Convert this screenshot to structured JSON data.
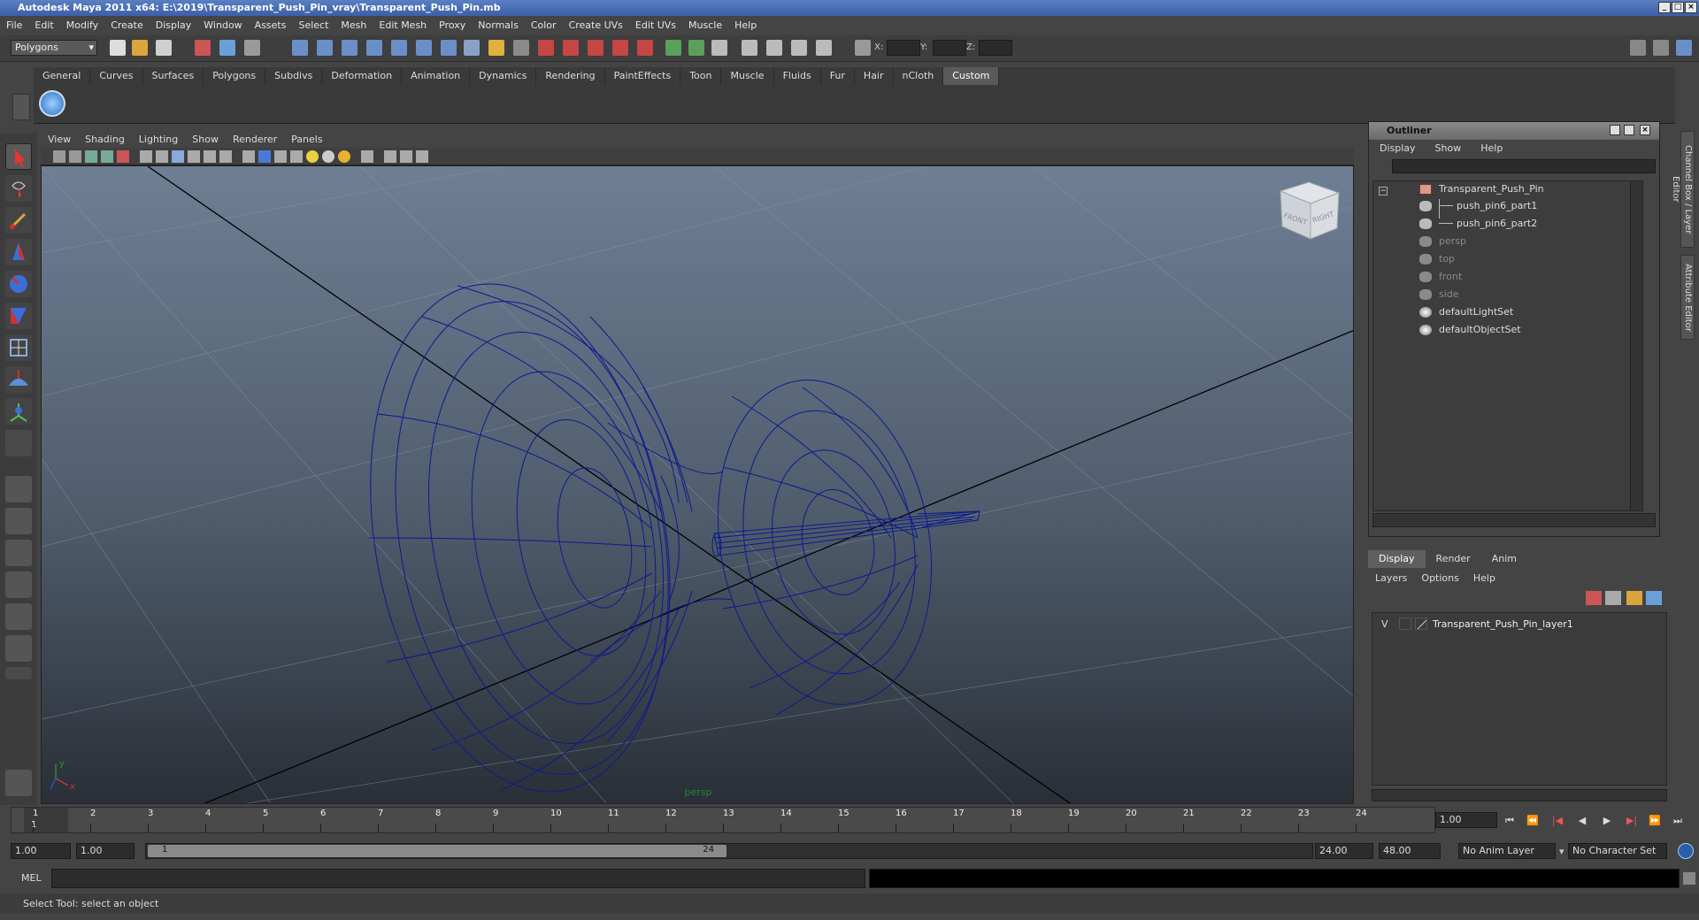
{
  "title": "Autodesk Maya 2011 x64: E:\\2019\\Transparent_Push_Pin_vray\\Transparent_Push_Pin.mb",
  "menubar": [
    "File",
    "Edit",
    "Modify",
    "Create",
    "Display",
    "Window",
    "Assets",
    "Select",
    "Mesh",
    "Edit Mesh",
    "Proxy",
    "Normals",
    "Color",
    "Create UVs",
    "Edit UVs",
    "Muscle",
    "Help"
  ],
  "toolbar": {
    "mode": "Polygons",
    "x_label": "X:",
    "y_label": "Y:",
    "z_label": "Z:"
  },
  "shelf_tabs": [
    "General",
    "Curves",
    "Surfaces",
    "Polygons",
    "Subdivs",
    "Deformation",
    "Animation",
    "Dynamics",
    "Rendering",
    "PaintEffects",
    "Toon",
    "Muscle",
    "Fluids",
    "Fur",
    "Hair",
    "nCloth",
    "Custom"
  ],
  "shelf_active": "Custom",
  "viewport": {
    "menu": [
      "View",
      "Shading",
      "Lighting",
      "Show",
      "Renderer",
      "Panels"
    ],
    "camera_label": "persp",
    "viewcube": {
      "front": "FRONT",
      "right": "RIGHT"
    },
    "axis": {
      "x": "x",
      "y": "y"
    }
  },
  "outliner": {
    "title": "Outliner",
    "menu": [
      "Display",
      "Show",
      "Help"
    ],
    "items": [
      {
        "label": "Transparent_Push_Pin",
        "icon": "group-icon",
        "dim": false
      },
      {
        "label": "push_pin6_part1",
        "icon": "mesh-icon",
        "dim": false
      },
      {
        "label": "push_pin6_part2",
        "icon": "mesh-icon",
        "dim": false
      },
      {
        "label": "persp",
        "icon": "camera-icon",
        "dim": true
      },
      {
        "label": "top",
        "icon": "camera-icon",
        "dim": true
      },
      {
        "label": "front",
        "icon": "camera-icon",
        "dim": true
      },
      {
        "label": "side",
        "icon": "camera-icon",
        "dim": true
      },
      {
        "label": "defaultLightSet",
        "icon": "set-icon",
        "dim": false
      },
      {
        "label": "defaultObjectSet",
        "icon": "set-icon",
        "dim": false
      }
    ]
  },
  "layer_editor": {
    "tabs": [
      "Display",
      "Render",
      "Anim"
    ],
    "active_tab": "Display",
    "menu": [
      "Layers",
      "Options",
      "Help"
    ],
    "layers": [
      {
        "visible": "V",
        "name": "Transparent_Push_Pin_layer1"
      }
    ]
  },
  "side_tabs": [
    "Channel Box / Layer Editor",
    "Attribute Editor"
  ],
  "timeline": {
    "frames": [
      "1",
      "2",
      "3",
      "4",
      "5",
      "6",
      "7",
      "8",
      "9",
      "10",
      "11",
      "12",
      "13",
      "14",
      "15",
      "16",
      "17",
      "18",
      "19",
      "20",
      "21",
      "22",
      "23",
      "24"
    ],
    "current_frame": "1",
    "current_time": "1.00"
  },
  "range": {
    "start": "1.00",
    "playback_start": "1.00",
    "slider_start": "1",
    "slider_end": "24",
    "playback_end": "24.00",
    "end": "48.00",
    "anim_layer": "No Anim Layer",
    "char_set": "No Character Set"
  },
  "command_line": {
    "label": "MEL"
  },
  "status": "Select Tool: select an object",
  "colors": {
    "wire": "#0d1a8c",
    "viewport_top": "#6e7f94",
    "viewport_bottom": "#2a2f37"
  }
}
